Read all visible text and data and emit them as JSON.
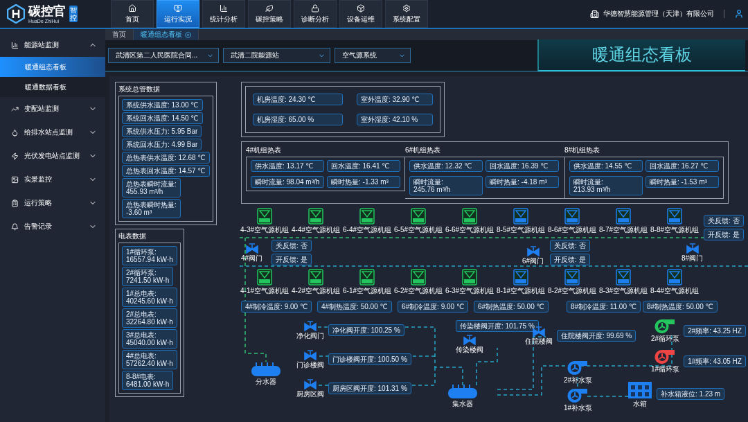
{
  "header": {
    "logo_text": "碳控官",
    "logo_sub": "HuaDe ZhiHui",
    "logo_badge": "智控",
    "company": "华德智慧能源管理（天津）有限公司",
    "nav": [
      {
        "label": "首页",
        "selected": false
      },
      {
        "label": "运行实况",
        "selected": true
      },
      {
        "label": "统计分析",
        "selected": false
      },
      {
        "label": "碳控策略",
        "selected": false
      },
      {
        "label": "诊断分析",
        "selected": false
      },
      {
        "label": "设备运维",
        "selected": false
      },
      {
        "label": "系统配置",
        "selected": false
      }
    ]
  },
  "sidebar": {
    "items": [
      {
        "label": "能源站监测",
        "expanded": true,
        "children": [
          {
            "label": "暖通组态看板",
            "selected": true
          },
          {
            "label": "暖通数据看板",
            "selected": false
          }
        ]
      },
      {
        "label": "变配站监测",
        "expanded": false
      },
      {
        "label": "给排水站点监测",
        "expanded": false
      },
      {
        "label": "光伏发电站点监测",
        "expanded": false
      },
      {
        "label": "实景监控",
        "expanded": false
      },
      {
        "label": "运行策略",
        "expanded": false
      },
      {
        "label": "告警记录",
        "expanded": false
      }
    ]
  },
  "tabs": [
    {
      "label": "首页",
      "selected": false
    },
    {
      "label": "暖通组态看板",
      "selected": true
    }
  ],
  "filters": [
    {
      "value": "武清区第二人民医院合同..."
    },
    {
      "value": "武清二院能源站"
    },
    {
      "value": "空气源系统"
    }
  ],
  "title": "暖通组态看板",
  "diagram": {
    "environment": [
      {
        "label": "机房温度:",
        "value": "24.30 ℃"
      },
      {
        "label": "室外温度:",
        "value": "32.90 ℃"
      },
      {
        "label": "机房湿度:",
        "value": "65.00 %"
      },
      {
        "label": "室外湿度:",
        "value": "42.10 %"
      }
    ],
    "main_pipe": {
      "title": "系统总管数据",
      "readings": [
        {
          "label": "系统供水温度:",
          "value": "13.00 ℃",
          "kind": "inline"
        },
        {
          "label": "系统回水温度:",
          "value": "14.50 ℃",
          "kind": "inline"
        },
        {
          "label": "系统供水压力:",
          "value": "5.95 Bar",
          "kind": "inline"
        },
        {
          "label": "系统回水压力:",
          "value": "4.99 Bar",
          "kind": "inline"
        },
        {
          "label": "总热表供水温度:",
          "value": "12.68 ℃",
          "kind": "inline"
        },
        {
          "label": "总热表回水温度:",
          "value": "14.57 ℃",
          "kind": "inline"
        },
        {
          "label": "总热表瞬时流量:",
          "value": "455.93 m³/h",
          "kind": "stacked"
        },
        {
          "label": "总热表瞬时热量:",
          "value": "-3.60 m³",
          "kind": "stacked"
        }
      ]
    },
    "meters": {
      "title": "电表数据",
      "readings": [
        {
          "label": "1#循环泵:",
          "value": "16557.94 kW·h",
          "kind": "stacked"
        },
        {
          "label": "2#循环泵:",
          "value": "7241.50 kW·h",
          "kind": "stacked"
        },
        {
          "label": "1#总电表:",
          "value": "40245.60 kW·h",
          "kind": "stacked"
        },
        {
          "label": "2#总电表:",
          "value": "32264.80 kW·h",
          "kind": "stacked"
        },
        {
          "label": "3#总电表:",
          "value": "45040.00 kW·h",
          "kind": "stacked"
        },
        {
          "label": "4#总电表:",
          "value": "57262.40 kW·h",
          "kind": "stacked"
        },
        {
          "label": "8-8#电表:",
          "value": "6481.00 kW·h",
          "kind": "stacked"
        }
      ]
    },
    "heat_meters": [
      {
        "title": "4#机组热表",
        "readings": [
          {
            "label": "供水温度:",
            "value": "13.17 ℃",
            "kind": "inline"
          },
          {
            "label": "回水温度:",
            "value": "16.41 ℃",
            "kind": "inline"
          },
          {
            "label": "瞬时流量:",
            "value": "98.04 m³/h",
            "kind": "inline"
          },
          {
            "label": "瞬时热量:",
            "value": "-1.33 m³",
            "kind": "inline"
          }
        ]
      },
      {
        "title": "6#机组热表",
        "readings": [
          {
            "label": "供水温度:",
            "value": "12.32 ℃",
            "kind": "inline"
          },
          {
            "label": "回水温度:",
            "value": "16.39 ℃",
            "kind": "inline"
          },
          {
            "label": "瞬时流量:",
            "value": "245.76 m³/h",
            "kind": "stacked"
          },
          {
            "label": "瞬时热量:",
            "value": "-4.18 m³",
            "kind": "inline"
          }
        ]
      },
      {
        "title": "8#机组热表",
        "readings": [
          {
            "label": "供水温度:",
            "value": "14.55 ℃",
            "kind": "inline"
          },
          {
            "label": "回水温度:",
            "value": "16.27 ℃",
            "kind": "inline"
          },
          {
            "label": "瞬时流量:",
            "value": "213.93 m³/h",
            "kind": "stacked"
          },
          {
            "label": "瞬时热量:",
            "value": "-1.53 m³",
            "kind": "inline"
          }
        ]
      }
    ],
    "units_top": [
      {
        "label": "4-3#空气源机组",
        "color": "#22c55e"
      },
      {
        "label": "4-4#空气源机组",
        "color": "#22c55e"
      },
      {
        "label": "6-4#空气源机组",
        "color": "#22c55e"
      },
      {
        "label": "6-5#空气源机组",
        "color": "#22c55e"
      },
      {
        "label": "6-6#空气源机组",
        "color": "#22c55e"
      },
      {
        "label": "8-5#空气源机组",
        "color": "#1e7ff0"
      },
      {
        "label": "8-6#空气源机组",
        "color": "#1e7ff0"
      },
      {
        "label": "8-7#空气源机组",
        "color": "#1e7ff0"
      },
      {
        "label": "8-8#空气源机组",
        "color": "#1e7ff0"
      }
    ],
    "units_bottom": [
      {
        "label": "4-1#空气源机组",
        "color": "#22c55e"
      },
      {
        "label": "4-2#空气源机组",
        "color": "#22c55e"
      },
      {
        "label": "6-1#空气源机组",
        "color": "#22c55e"
      },
      {
        "label": "6-2#空气源机组",
        "color": "#22c55e"
      },
      {
        "label": "6-3#空气源机组",
        "color": "#22c55e"
      },
      {
        "label": "8-1#空气源机组",
        "color": "#1e7ff0"
      },
      {
        "label": "8-2#空气源机组",
        "color": "#1e7ff0"
      },
      {
        "label": "8-3#空气源机组",
        "color": "#1e7ff0"
      },
      {
        "label": "8-4#空气源机组",
        "color": "#1e7ff0"
      }
    ],
    "unit_valves": [
      {
        "label": "4#阀门",
        "close_feedback": "关反馈: 否",
        "open_feedback": "开反馈: 是"
      },
      {
        "label": "6#阀门",
        "close_feedback": "关反馈: 否",
        "open_feedback": "开反馈: 是"
      },
      {
        "label": "8#阀门",
        "close_feedback": "关反馈: 否",
        "open_feedback": "开反馈: 是"
      }
    ],
    "unit_temperatures": [
      "4#制冷温度: 9.00 ℃",
      "4#制热温度: 50.00 ℃",
      "6#制冷温度: 9.00 ℃",
      "6#制热温度: 50.00 ℃",
      "8#制冷温度: 11.00 ℃",
      "8#制热温度: 50.00 ℃"
    ],
    "branch_valves": [
      {
        "label": "净化阀门",
        "opening": "净化阀开度: 100.25 %"
      },
      {
        "label": "门诊楼阀",
        "opening": "门诊楼阀开度: 100.50 %"
      },
      {
        "label": "厨房区阀",
        "opening": "厨房区阀开度: 101.31 %"
      },
      {
        "label": "传染楼阀",
        "opening": "传染楼阀开度: 101.75 %"
      },
      {
        "label": "住院楼阀",
        "opening": "住院楼阀开度: 99.69 %"
      }
    ],
    "collectors": [
      {
        "label": "分水器"
      },
      {
        "label": "集水器"
      }
    ],
    "circulation_pumps": [
      {
        "label": "2#循环泵",
        "color": "#22c55e",
        "frequency": "2#频率: 43.25 HZ"
      },
      {
        "label": "1#循环泵",
        "color": "#ef4444",
        "frequency": "1#频率: 43.05 HZ"
      }
    ],
    "makeup_pumps": [
      {
        "label": "2#补水泵"
      },
      {
        "label": "1#补水泵"
      }
    ],
    "tank": {
      "label": "水箱",
      "level_text": "补水箱液位: 1.23 m"
    }
  }
}
